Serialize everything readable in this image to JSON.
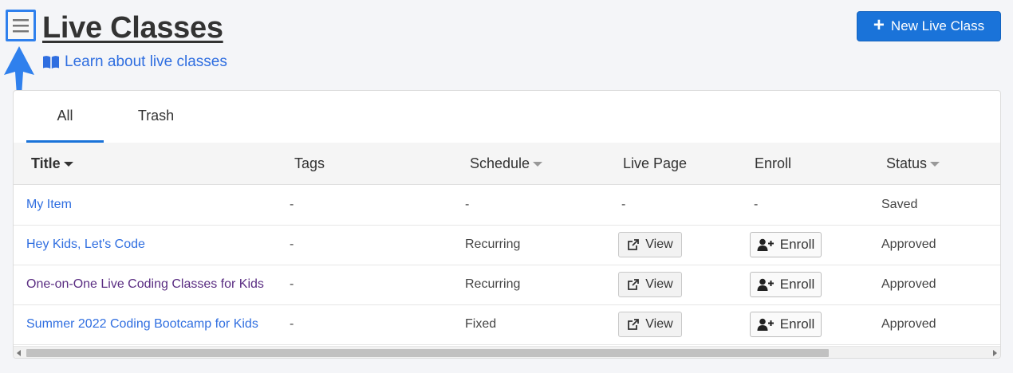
{
  "header": {
    "title": "Live Classes",
    "learn_link": "Learn about live classes",
    "new_button": "New Live Class",
    "new_button_plus": "+"
  },
  "tabs": [
    {
      "label": "All",
      "active": true
    },
    {
      "label": "Trash",
      "active": false
    }
  ],
  "columns": {
    "title": "Title",
    "tags": "Tags",
    "schedule": "Schedule",
    "live_page": "Live Page",
    "enroll": "Enroll",
    "status": "Status"
  },
  "rows": [
    {
      "title": "My Item",
      "tags": "-",
      "schedule": "-",
      "live_page": "-",
      "enroll": "-",
      "status": "Saved"
    },
    {
      "title": "Hey Kids, Let's Code",
      "tags": "-",
      "schedule": "Recurring",
      "live_page": "View",
      "enroll": "Enroll",
      "status": "Approved"
    },
    {
      "title": "One-on-One Live Coding Classes for Kids",
      "tags": "-",
      "schedule": "Recurring",
      "live_page": "View",
      "enroll": "Enroll",
      "status": "Approved"
    },
    {
      "title": "Summer 2022 Coding Bootcamp for Kids",
      "tags": "-",
      "schedule": "Fixed",
      "live_page": "View",
      "enroll": "Enroll",
      "status": "Approved"
    }
  ],
  "colors": {
    "accent": "#1a73d9",
    "link": "#2f6ee0",
    "visited_link": "#5a2d82",
    "highlight": "#2f80ed"
  },
  "icons": [
    "menu-icon",
    "book-icon",
    "plus-icon",
    "external-link-icon",
    "add-user-icon",
    "sort-down-icon",
    "pointer-arrow"
  ]
}
